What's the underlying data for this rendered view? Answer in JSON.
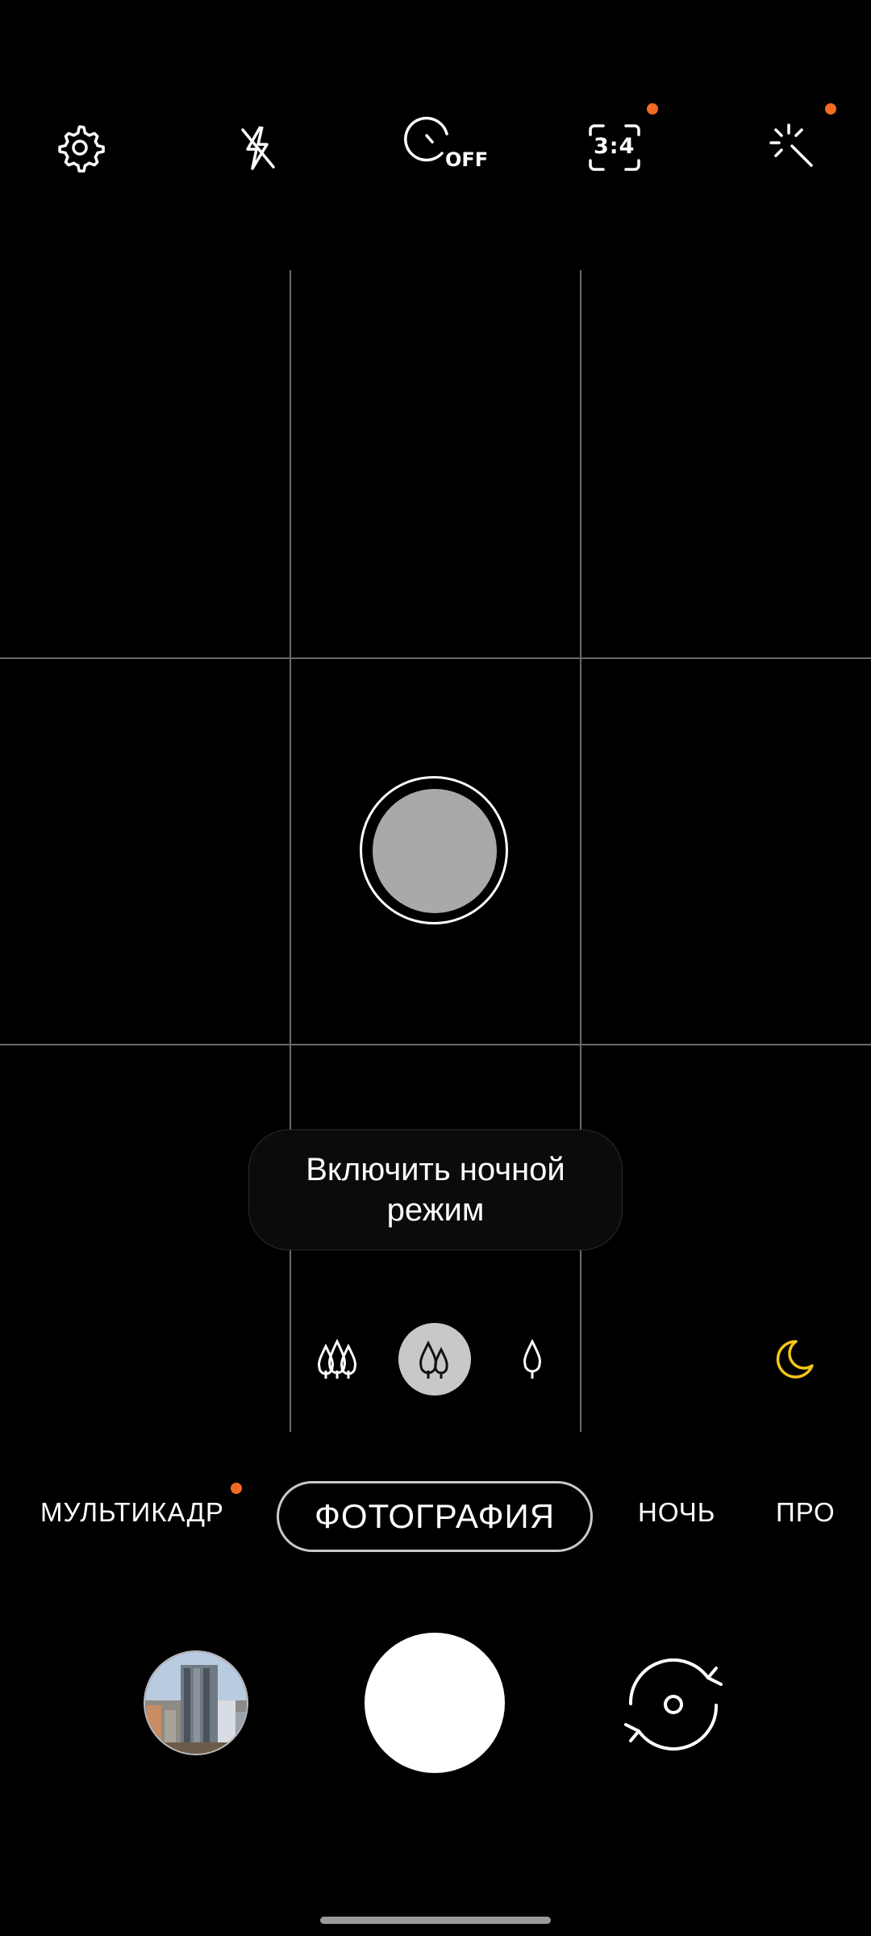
{
  "top_bar": {
    "settings_icon": "gear-icon",
    "flash_icon": "flash-off-icon",
    "timer_icon": "timer-icon",
    "timer_label": "OFF",
    "ratio_label": "3:4",
    "filters_icon": "effects-wand-icon",
    "notification_dot_color": "#f26b21"
  },
  "tooltip": {
    "text": "Включить ночной режим"
  },
  "zoom": {
    "options": [
      "wide-angle-icon",
      "standard-icon",
      "telephoto-icon"
    ],
    "active_index": 1,
    "night_icon_color": "#f5c518"
  },
  "modes": {
    "items": [
      "МУЛЬТИКАДР",
      "ФОТОГРАФИЯ",
      "НОЧЬ",
      "ПРО"
    ],
    "active": "ФОТОГРАФИЯ"
  },
  "bottom": {
    "gallery_icon": "gallery-thumbnail",
    "shutter_icon": "shutter-button",
    "flip_icon": "switch-camera-icon"
  }
}
